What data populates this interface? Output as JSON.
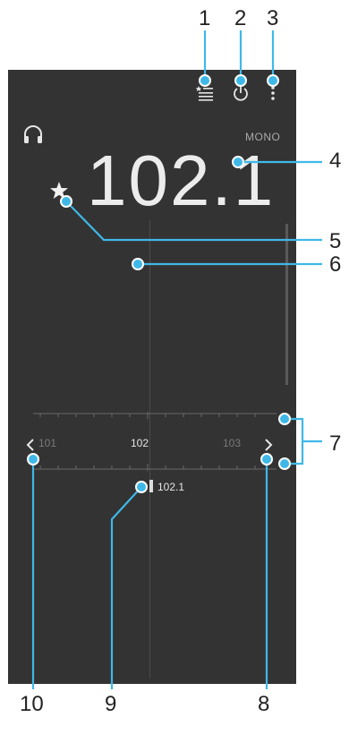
{
  "callouts": [
    "1",
    "2",
    "3",
    "4",
    "5",
    "6",
    "7",
    "8",
    "9",
    "10"
  ],
  "status": {
    "mono_label": "MONO"
  },
  "frequency": {
    "display": "102.1",
    "current_marker": "102.1"
  },
  "tuner": {
    "ticks": [
      "101",
      "102",
      "103"
    ]
  },
  "icons": {
    "favorites_list": "favorites-list-icon",
    "power": "power-icon",
    "more": "more-vert-icon",
    "headphones": "headphones-icon",
    "favorite_star": "star-icon",
    "prev": "chevron-left-icon",
    "next": "chevron-right-icon"
  },
  "colors": {
    "screen_bg": "#333333",
    "callout": "#3fb8e8",
    "text": "#ececec"
  }
}
